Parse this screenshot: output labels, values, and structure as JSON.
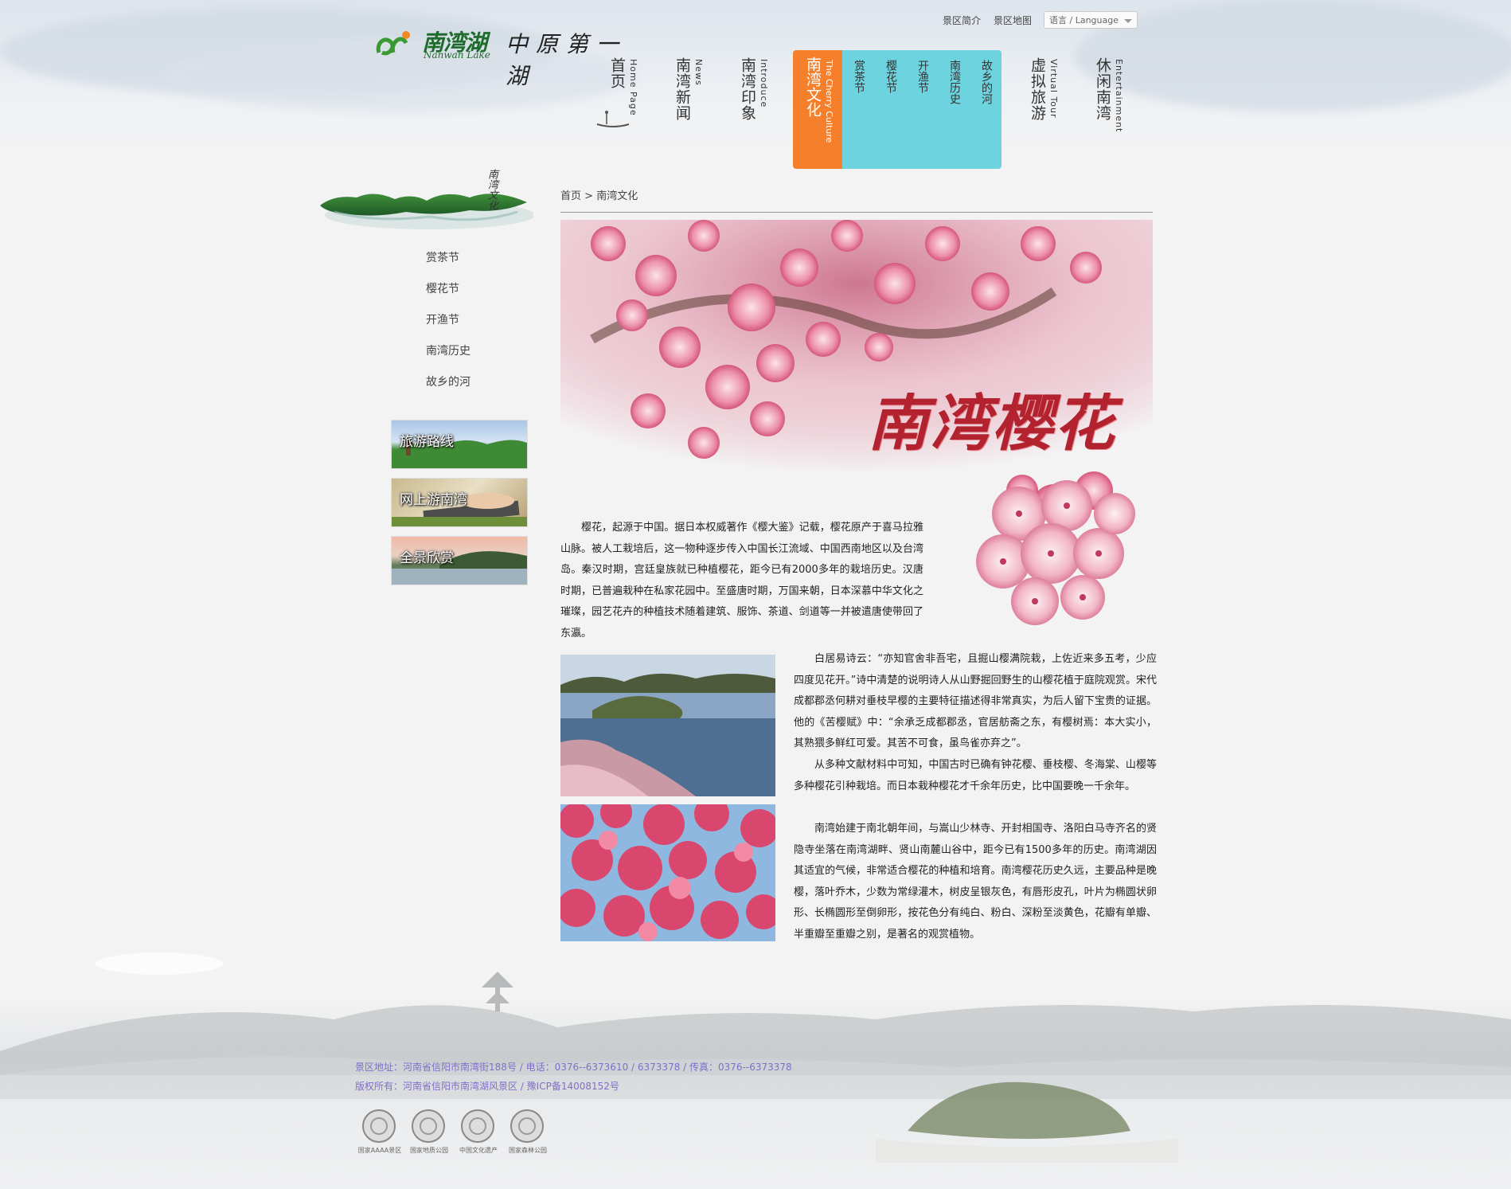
{
  "logo": {
    "name": "南湾湖",
    "sub": "Nanwan Lake",
    "slogan": "中原第一湖"
  },
  "toplinks": {
    "intro": "景区简介",
    "map": "景区地图",
    "language": "语言 / Language"
  },
  "nav": [
    {
      "cn": "首页",
      "en": "Home Page"
    },
    {
      "cn": "南湾新闻",
      "en": "News"
    },
    {
      "cn": "南湾印象",
      "en": "Introduce"
    },
    {
      "cn": "南湾文化",
      "en": "The Cherry Culture"
    },
    {
      "cn": "虚拟旅游",
      "en": "Virtual Tour"
    },
    {
      "cn": "休闲南湾",
      "en": "Entertainment"
    }
  ],
  "subnav": [
    "赏茶节",
    "樱花节",
    "开渔节",
    "南湾历史",
    "故乡的河"
  ],
  "sidebar": {
    "banner_text": "南湾文化",
    "links": [
      "赏茶节",
      "樱花节",
      "开渔节",
      "南湾历史",
      "故乡的河"
    ],
    "promos": [
      "旅游路线",
      "网上游南湾",
      "全景欣赏"
    ]
  },
  "breadcrumb": {
    "home": "首页",
    "sep": " > ",
    "current": "南湾文化"
  },
  "hero_title": "南湾樱花",
  "content": {
    "p1": "樱花，起源于中国。据日本权威著作《樱大鉴》记载，樱花原产于喜马拉雅山脉。被人工栽培后，这一物种逐步传入中国长江流域、中国西南地区以及台湾岛。秦汉时期，宫廷皇族就已种植樱花，距今已有2000多年的栽培历史。汉唐时期，已普遍栽种在私家花园中。至盛唐时期，万国来朝，日本深慕中华文化之璀璨，园艺花卉的种植技术随着建筑、服饰、茶道、剑道等一并被遣唐使带回了东瀛。",
    "p2": "白居易诗云：“亦知官舍非吾宅，且掘山樱满院栽，上佐近来多五考，少应四度见花开。”诗中清楚的说明诗人从山野掘回野生的山樱花植于庭院观赏。宋代成都郡丞何耕对垂枝早樱的主要特征描述得非常真实，为后人留下宝贵的证据。他的《苦樱赋》中：“余承乏成都郡丞，官居舫斋之东，有樱树焉：本大实小，其熟猥多鲜红可爱。其苦不可食，虽鸟雀亦弃之”。",
    "p3": "从多种文献材料中可知，中国古时已确有钟花樱、垂枝樱、冬海棠、山樱等多种樱花引种栽培。而日本栽种樱花才千余年历史，比中国要晚一千余年。",
    "p4": "南湾始建于南北朝年间，与嵩山少林寺、开封相国寺、洛阳白马寺齐名的贤隐寺坐落在南湾湖畔、贤山南麓山谷中，距今已有1500多年的历史。南湾湖因其适宜的气候，非常适合樱花的种植和培育。南湾樱花历史久远，主要品种是晚樱，落叶乔木，少数为常绿灌木，树皮呈银灰色，有唇形皮孔，叶片为椭圆状卵形、长椭圆形至倒卵形，按花色分有纯白、粉白、深粉至淡黄色，花瓣有单瓣、半重瓣至重瓣之别，是著名的观赏植物。"
  },
  "footer": {
    "line1": "景区地址：河南省信阳市南湾街188号 / 电话：0376--6373610 / 6373378 / 传真：0376--6373378",
    "line2": "版权所有：河南省信阳市南湾湖风景区 / 豫ICP备14008152号",
    "badges": [
      "国家AAAA景区",
      "国家地质公园",
      "中国文化遗产",
      "国家森林公园"
    ]
  }
}
